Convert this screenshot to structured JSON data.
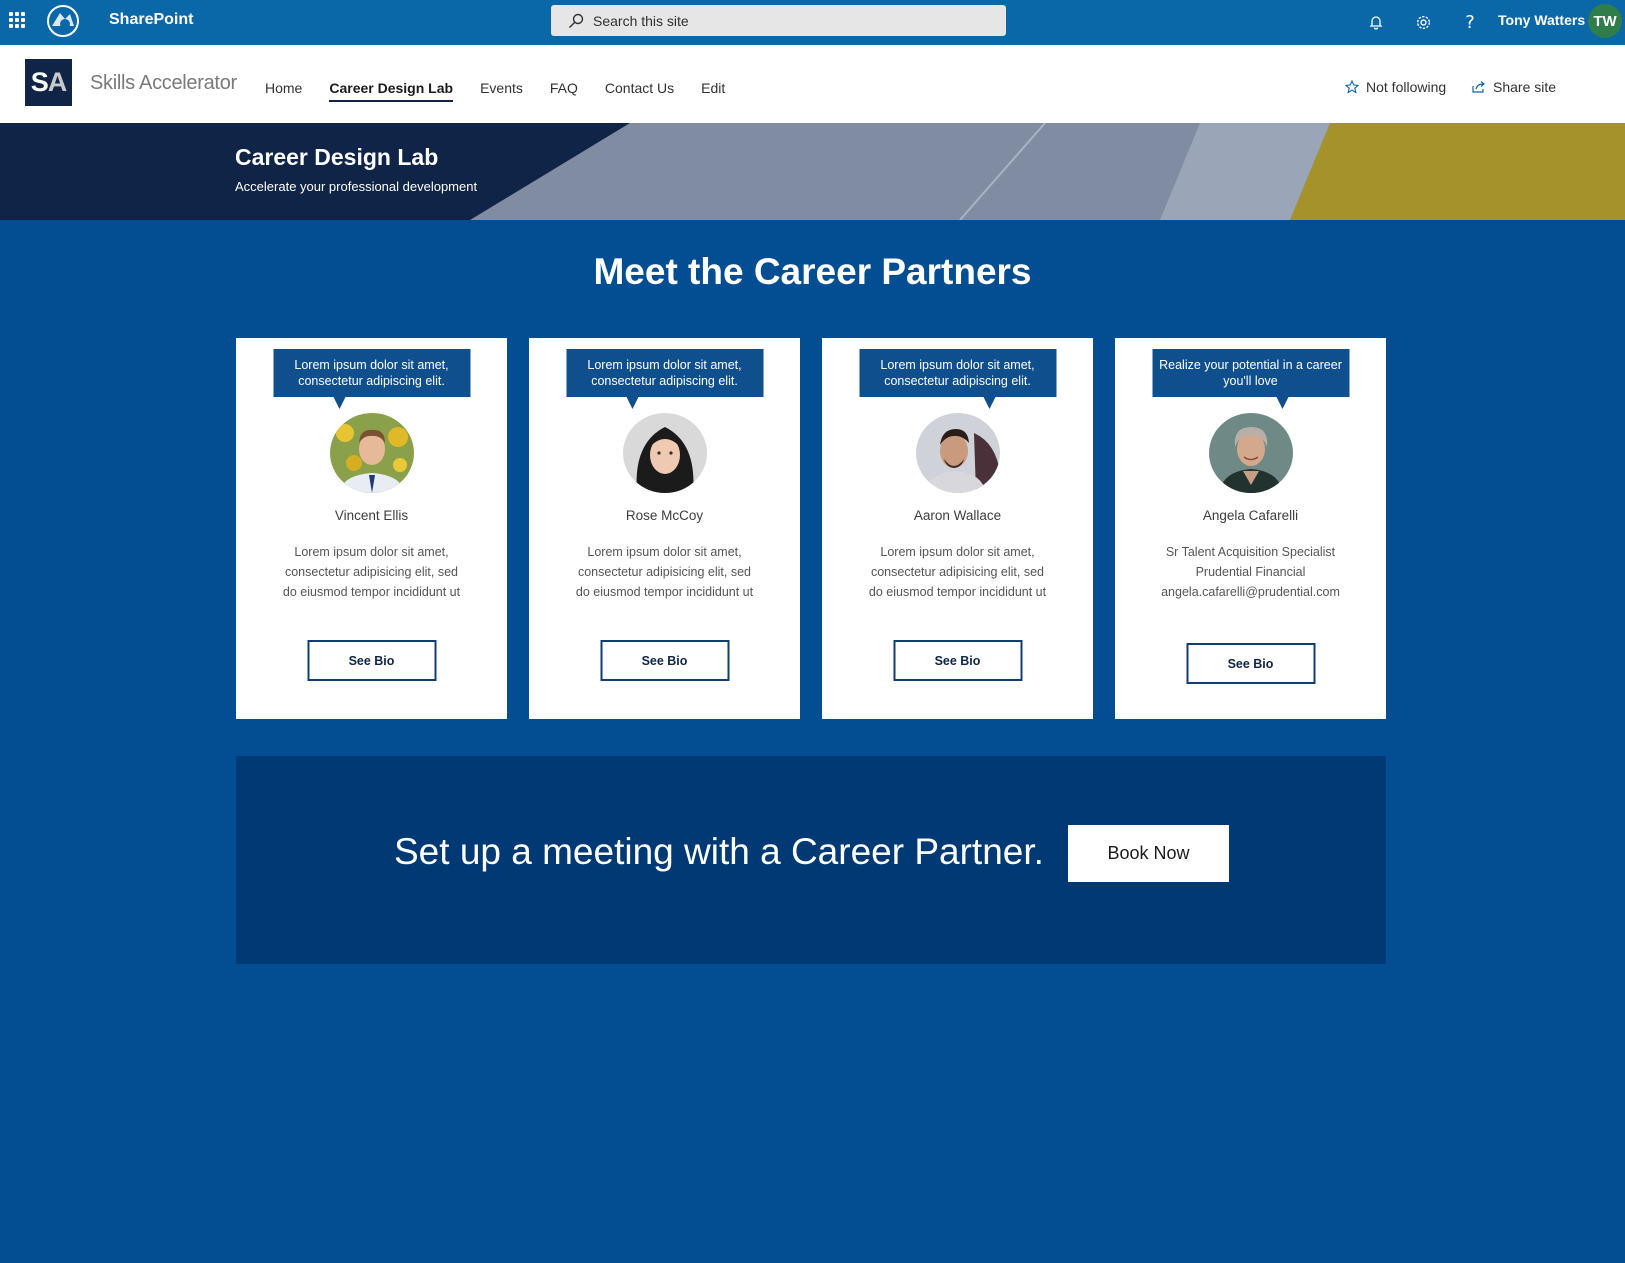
{
  "suite": {
    "app_name": "SharePoint",
    "search_placeholder": "Search this site",
    "user_name": "Tony Watters",
    "user_initials": "TW"
  },
  "site": {
    "logo_s": "S",
    "logo_a": "A",
    "title": "Skills Accelerator",
    "nav": [
      {
        "label": "Home"
      },
      {
        "label": "Career Design Lab",
        "active": true
      },
      {
        "label": "Events"
      },
      {
        "label": "FAQ"
      },
      {
        "label": "Contact Us"
      },
      {
        "label": "Edit"
      }
    ],
    "follow_label": "Not following",
    "share_label": "Share site"
  },
  "banner": {
    "title": "Career Design Lab",
    "subtitle": "Accelerate your professional development"
  },
  "main": {
    "heading": "Meet the Career Partners",
    "partners": [
      {
        "bubble": "Lorem ipsum dolor sit amet, consectetur adipiscing elit.",
        "name": "Vincent Ellis",
        "desc": [
          "Lorem ipsum dolor sit amet,",
          "consectetur adipisicing elit, sed",
          "do eiusmod tempor incididunt ut"
        ],
        "button": "See Bio"
      },
      {
        "bubble": "Lorem ipsum dolor sit amet, consectetur adipiscing elit.",
        "name": "Rose McCoy",
        "desc": [
          "Lorem ipsum dolor sit amet,",
          "consectetur adipisicing elit, sed",
          "do eiusmod tempor incididunt ut"
        ],
        "button": "See Bio"
      },
      {
        "bubble": "Lorem ipsum dolor sit amet, consectetur adipiscing elit.",
        "name": "Aaron Wallace",
        "desc": [
          "Lorem ipsum dolor sit amet,",
          "consectetur adipisicing elit, sed",
          "do eiusmod tempor incididunt ut"
        ],
        "button": "See Bio"
      },
      {
        "bubble": "Realize your potential in a career you'll love",
        "name": "Angela Cafarelli",
        "desc": [
          "Sr Talent Acquisition Specialist",
          "Prudential Financial",
          "angela.cafarelli@prudential.com"
        ],
        "button": "See Bio"
      }
    ]
  },
  "cta": {
    "text": "Set up a meeting with a Career Partner.",
    "button": "Book Now"
  },
  "colors": {
    "suite_bar": "#0a67a8",
    "page_bg": "#034e93",
    "cta_bg": "#003973",
    "banner_dark": "#0f2447",
    "banner_accent": "#a6922a"
  }
}
